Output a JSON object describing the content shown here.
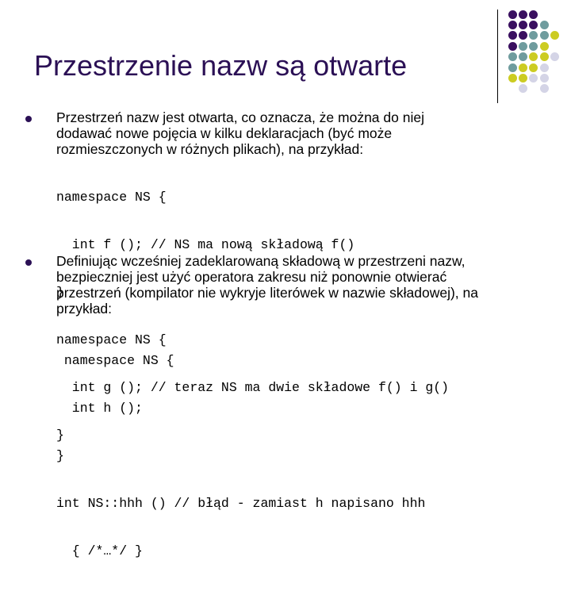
{
  "slide": {
    "title": "Przestrzenie nazw są otwarte",
    "colors": {
      "title": "#2b1055",
      "purple": "#3a1060",
      "teal": "#6f9c9e",
      "yellow": "#cccc22",
      "lavender": "#d4d4e6"
    },
    "decoration": {
      "grid": [
        [
          "P",
          "P",
          "P",
          ".",
          "."
        ],
        [
          "P",
          "P",
          "P",
          "T",
          "."
        ],
        [
          "P",
          "P",
          "T",
          "T",
          "Y"
        ],
        [
          "P",
          "T",
          "T",
          "Y",
          "."
        ],
        [
          "T",
          "T",
          "Y",
          "Y",
          "L"
        ],
        [
          "T",
          "Y",
          "Y",
          "L",
          "."
        ],
        [
          "Y",
          "Y",
          "L",
          "L",
          "."
        ],
        [
          ".",
          "L",
          ".",
          "L",
          "."
        ]
      ]
    },
    "bullets": [
      {
        "lines": [
          "Przestrzeń nazw jest otwarta, co oznacza, że można do niej",
          "dodawać nowe pojęcia w kilku deklaracjach (być może",
          "rozmieszczonych w różnych plikach), na przykład:"
        ],
        "code": [
          "namespace NS {",
          "  int f (); // NS ma nową składową f()",
          "}",
          "namespace NS {",
          "  int g (); // teraz NS ma dwie składowe f() i g()",
          "}"
        ]
      },
      {
        "lines": [
          "Definiując wcześniej zadeklarowaną składową w przestrzeni nazw,",
          "bezpieczniej jest użyć operatora zakresu niż ponownie otwierać",
          "przestrzeń (kompilator nie wykryje literówek w nazwie składowej), na",
          "przykład:"
        ],
        "code": [
          " namespace NS {",
          "  int h ();",
          "}",
          "int NS::hhh () // błąd - zamiast h napisano hhh",
          "  { /*…*/ }"
        ]
      }
    ]
  }
}
